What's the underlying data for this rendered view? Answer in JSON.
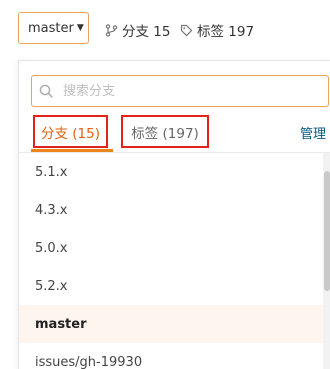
{
  "header": {
    "current_branch": "master",
    "branches_stat": "分支 15",
    "tags_stat": "标签 197"
  },
  "dropdown": {
    "search_placeholder": "搜索分支",
    "tabs": [
      {
        "label": "分支 (15)",
        "active": true
      },
      {
        "label": "标签 (197)",
        "active": false
      }
    ],
    "manage_label": "管理",
    "items": [
      "5.1.x",
      "4.3.x",
      "5.0.x",
      "5.2.x",
      "master",
      "issues/gh-19930"
    ],
    "active_item": "master"
  },
  "colors": {
    "accent": "#f0841a",
    "active_tab_text": "#e1620f",
    "highlight_border": "#e2231a",
    "manage_link": "#005980",
    "active_row_bg": "#fdf5ee"
  }
}
